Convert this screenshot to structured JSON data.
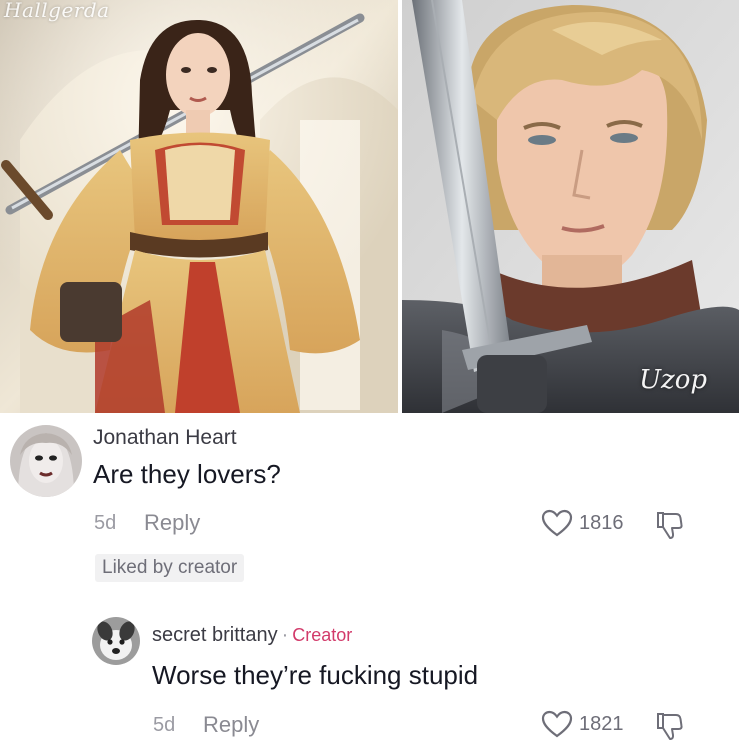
{
  "images": {
    "left": {
      "watermark": "Hallgerda",
      "icon": "medieval-lady-with-sword-artwork"
    },
    "right": {
      "watermark": "Uzop",
      "icon": "knight-in-armor-portrait-artwork"
    }
  },
  "comments": [
    {
      "author": "Jonathan Heart",
      "text": "Are they lovers?",
      "age": "5d",
      "reply_label": "Reply",
      "likes": "1816",
      "liked_by_label": "Liked by creator",
      "avatar_icon": "pale-woman-avatar"
    },
    {
      "author": "secret brittany",
      "separator": "·",
      "badge": "Creator",
      "text": "Worse they’re fucking stupid",
      "age": "5d",
      "reply_label": "Reply",
      "likes": "1821",
      "avatar_icon": "dog-avatar"
    }
  ],
  "icons": {
    "like": "heart-outline-icon",
    "dislike": "thumbs-down-icon"
  },
  "colors": {
    "text": "#161823",
    "muted": "#9b9ba3",
    "creator": "#d23a6a",
    "chip_bg": "#f1f1f2"
  }
}
